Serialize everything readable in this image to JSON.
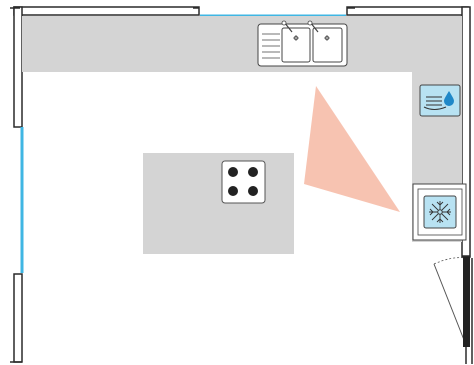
{
  "plan": {
    "kind": "kitchen-floor-plan",
    "colors": {
      "background": "#ffffff",
      "wall": "#2a2a2a",
      "counter": "#d4d4d4",
      "counter_edge": "#b0b0b0",
      "window": "#3fb6e3",
      "work_triangle": "#f6b8a3",
      "appliance_icon_bg": "#b8e2f2",
      "icon_stroke": "#333333",
      "water_drop": "#1f88c8"
    },
    "fixtures": [
      {
        "name": "sink",
        "icon": "double-sink-icon"
      },
      {
        "name": "cooktop",
        "icon": "cooktop-icon",
        "burners": 4
      },
      {
        "name": "dishwasher",
        "icon": "dishwasher-icon"
      },
      {
        "name": "refrigerator",
        "icon": "refrigerator-icon"
      },
      {
        "name": "door",
        "icon": "door-swing-icon"
      }
    ],
    "windows": 2,
    "zones": [
      "top-counter",
      "right-counter",
      "island"
    ]
  }
}
